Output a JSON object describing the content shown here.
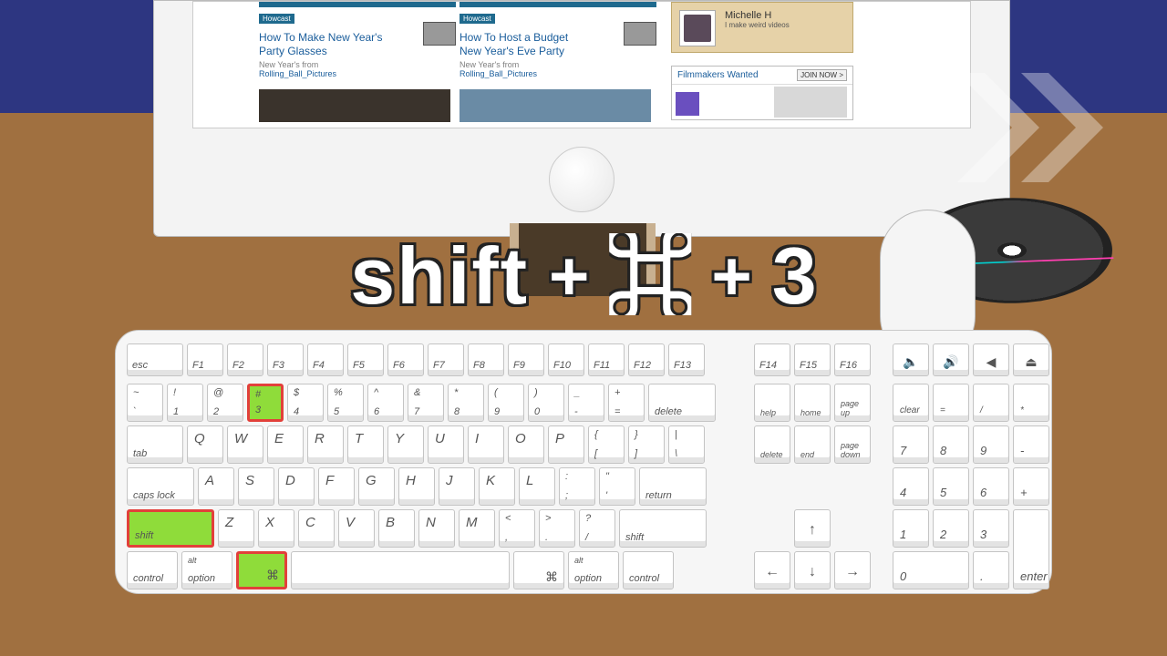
{
  "shortcut": {
    "text_shift": "shift",
    "plus": "+",
    "num": "3",
    "cmd_symbol": "⌘"
  },
  "screen": {
    "site_label": "Howcast",
    "card1": {
      "title": "How To Make New Year's Party Glasses",
      "meta_pre": "New Year's from",
      "author": "Rolling_Ball_Pictures"
    },
    "card2": {
      "title": "How To Host a Budget New Year's Eve Party",
      "meta_pre": "New Year's from",
      "author": "Rolling_Ball_Pictures"
    },
    "user": {
      "name": "Michelle H",
      "sub": "I make weird videos"
    },
    "promo": {
      "title": "Filmmakers Wanted",
      "button": "JOIN NOW >"
    }
  },
  "highlighted_keys": [
    "3",
    "shift",
    "command"
  ],
  "fn_row": [
    "esc",
    "F1",
    "F2",
    "F3",
    "F4",
    "F5",
    "F6",
    "F7",
    "F8",
    "F9",
    "F10",
    "F11",
    "F12",
    "F13"
  ],
  "fn_row2": [
    "F14",
    "F15",
    "F16"
  ],
  "media_row": [
    "🔈",
    "🔊",
    "◀",
    "⏏"
  ],
  "num_row": [
    {
      "top": "~",
      "bot": "`"
    },
    {
      "top": "!",
      "bot": "1"
    },
    {
      "top": "@",
      "bot": "2"
    },
    {
      "top": "#",
      "bot": "3"
    },
    {
      "top": "$",
      "bot": "4"
    },
    {
      "top": "%",
      "bot": "5"
    },
    {
      "top": "^",
      "bot": "6"
    },
    {
      "top": "&",
      "bot": "7"
    },
    {
      "top": "*",
      "bot": "8"
    },
    {
      "top": "(",
      "bot": "9"
    },
    {
      "top": ")",
      "bot": "0"
    },
    {
      "top": "_",
      "bot": "-"
    },
    {
      "top": "+",
      "bot": "="
    }
  ],
  "delete_label": "delete",
  "nav1": [
    "help",
    "home",
    "page up"
  ],
  "num_top": [
    "clear",
    "=",
    "/",
    "*"
  ],
  "tab_label": "tab",
  "row_q": [
    "Q",
    "W",
    "E",
    "R",
    "T",
    "Y",
    "U",
    "I",
    "O",
    "P"
  ],
  "brackets": [
    {
      "top": "{",
      "bot": "["
    },
    {
      "top": "}",
      "bot": "]"
    },
    {
      "top": "|",
      "bot": "\\"
    }
  ],
  "nav2": [
    "delete",
    "end",
    "page down"
  ],
  "np_789": [
    "7",
    "8",
    "9",
    "-"
  ],
  "caps_label": "caps lock",
  "row_a": [
    "A",
    "S",
    "D",
    "F",
    "G",
    "H",
    "J",
    "K",
    "L"
  ],
  "semis": [
    {
      "top": ":",
      "bot": ";"
    },
    {
      "top": "\"",
      "bot": "'"
    }
  ],
  "return_label": "return",
  "np_456": [
    "4",
    "5",
    "6",
    "+"
  ],
  "shift_label": "shift",
  "row_z": [
    "Z",
    "X",
    "C",
    "V",
    "B",
    "N",
    "M"
  ],
  "punct": [
    {
      "top": "<",
      "bot": ","
    },
    {
      "top": ">",
      "bot": "."
    },
    {
      "top": "?",
      "bot": "/"
    }
  ],
  "np_123": [
    "1",
    "2",
    "3"
  ],
  "mods": {
    "control": "control",
    "option": "option",
    "alt": "alt",
    "apple": "",
    "cmd": "⌘"
  },
  "np_bot": [
    "0",
    ".",
    "enter"
  ],
  "arrows": {
    "up": "↑",
    "left": "←",
    "down": "↓",
    "right": "→"
  }
}
